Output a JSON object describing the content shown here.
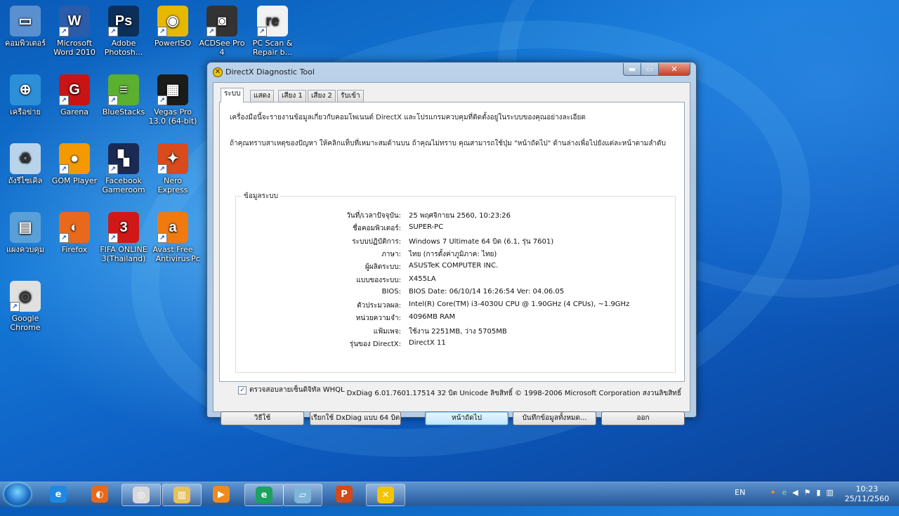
{
  "desktop": {
    "icons": [
      {
        "label": "คอมพิวเตอร์",
        "icon": "computer-icon",
        "color": "#5a8fd0",
        "glyph": "▭"
      },
      {
        "label": "Microsoft Word 2010",
        "icon": "word-icon",
        "color": "#2a5caa",
        "glyph": "W"
      },
      {
        "label": "Adobe Photosh...",
        "icon": "photoshop-icon",
        "color": "#0c2f5a",
        "glyph": "Ps"
      },
      {
        "label": "PowerISO",
        "icon": "poweriso-icon",
        "color": "#e6b800",
        "glyph": "◉"
      },
      {
        "label": "ACDSee Pro 4",
        "icon": "acdsee-icon",
        "color": "#333333",
        "glyph": "◙"
      },
      {
        "label": "PC Scan & Repair b...",
        "icon": "pcscan-icon",
        "color": "#f2f2f2",
        "glyph": "re"
      },
      {
        "label": "เครือข่าย",
        "icon": "network-icon",
        "color": "#2d8fd8",
        "glyph": "⊕"
      },
      {
        "label": "Garena",
        "icon": "garena-icon",
        "color": "#c81414",
        "glyph": "G"
      },
      {
        "label": "BlueStacks",
        "icon": "bluestacks-icon",
        "color": "#5bb030",
        "glyph": "≡"
      },
      {
        "label": "Vegas Pro 13.0 (64-bit)",
        "icon": "vegas-icon",
        "color": "#1b1b1b",
        "glyph": "▦"
      },
      {
        "label": "ถังรีไซเคิล",
        "icon": "recycle-bin-icon",
        "color": "#b9d4ea",
        "glyph": "♻"
      },
      {
        "label": "GOM Player",
        "icon": "gom-player-icon",
        "color": "#f29a00",
        "glyph": "●"
      },
      {
        "label": "Facebook Gameroom",
        "icon": "facebook-gameroom-icon",
        "color": "#1a2a55",
        "glyph": "▚"
      },
      {
        "label": "Nero Express",
        "icon": "nero-icon",
        "color": "#d94a1c",
        "glyph": "✦"
      },
      {
        "label": "แผงควบคุม",
        "icon": "control-panel-icon",
        "color": "#5aa0d8",
        "glyph": "▤"
      },
      {
        "label": "Firefox",
        "icon": "firefox-icon",
        "color": "#e8691c",
        "glyph": "◐"
      },
      {
        "label": "FIFA ONLINE 3(Thailand)",
        "icon": "fifa-icon",
        "color": "#d01818",
        "glyph": "3"
      },
      {
        "label": "Avast Free Antivirus",
        "icon": "avast-icon",
        "color": "#f07a10",
        "glyph": "a"
      },
      {
        "label": "Google Chrome",
        "icon": "chrome-icon",
        "color": "#e0e0e0",
        "glyph": "◎"
      }
    ],
    "partial_label": "Pc"
  },
  "window": {
    "title": "DirectX Diagnostic Tool",
    "controls": {
      "minimize": "▬",
      "maximize": "▭",
      "close": "✕"
    },
    "tabs": [
      "ระบบ",
      "แสดง",
      "เสียง 1",
      "เสียง 2",
      "รับเข้า"
    ],
    "intro1": "เครื่องมือนี้จะรายงานข้อมูลเกี่ยวกับคอมโพเนนต์ DirectX และโปรแกรมควบคุมที่ติดตั้งอยู่ในระบบของคุณอย่างละเอียด",
    "intro2": "ถ้าคุณทราบสาเหตุของปัญหา ให้คลิกแท็บที่เหมาะสมด้านบน ถ้าคุณไม่ทราบ คุณสามารถใช้ปุ่ม \"หน้าถัดไป\" ด้านล่างเพื่อไปยังแต่ละหน้าตามลำดับ",
    "group_title": "ข้อมูลระบบ",
    "info": [
      {
        "label": "วันที่/เวลาปัจจุบัน:",
        "value": "25 พฤศจิกายน 2560, 10:23:26"
      },
      {
        "label": "ชื่อคอมพิวเตอร์:",
        "value": "SUPER-PC"
      },
      {
        "label": "ระบบปฏิบัติการ:",
        "value": "Windows 7 Ultimate 64 บิต (6.1, รุ่น 7601)"
      },
      {
        "label": "ภาษา:",
        "value": "ไทย (การตั้งค่าภูมิภาค: ไทย)"
      },
      {
        "label": "ผู้ผลิตระบบ:",
        "value": "ASUSTeK COMPUTER INC."
      },
      {
        "label": "แบบของระบบ:",
        "value": "X455LA"
      },
      {
        "label": "BIOS:",
        "value": "BIOS Date: 06/10/14 16:26:54 Ver: 04.06.05"
      },
      {
        "label": "ตัวประมวลผล:",
        "value": "Intel(R) Core(TM) i3-4030U CPU @ 1.90GHz (4 CPUs), ~1.9GHz"
      },
      {
        "label": "หน่วยความจำ:",
        "value": "4096MB RAM"
      },
      {
        "label": "แฟ้มเพจ:",
        "value": "ใช้งาน 2251MB, ว่าง 5705MB"
      },
      {
        "label": "รุ่นของ DirectX:",
        "value": "DirectX 11"
      }
    ],
    "whql_label": "ตรวจสอบลายเซ็นดิจิทัล WHQL",
    "whql_checked": "✓",
    "copyright": "DxDiag 6.01.7601.17514 32 บิต Unicode  ลิขสิทธิ์ © 1998-2006 Microsoft Corporation  สงวนลิขสิทธิ์",
    "buttons": {
      "help": "วิธีใช้",
      "run64": "เรียกใช้ DxDiag แบบ 64 บิต",
      "next": "หน้าถัดไป",
      "save": "บันทึกข้อมูลทั้งหมด...",
      "exit": "ออก"
    }
  },
  "taskbar": {
    "items": [
      {
        "name": "ie-taskbar-icon",
        "color": "#1e88e5",
        "glyph": "e"
      },
      {
        "name": "firefox-taskbar-icon",
        "color": "#e8691c",
        "glyph": "◐"
      },
      {
        "name": "chrome-taskbar-icon",
        "color": "#d8d8d8",
        "glyph": "◎"
      },
      {
        "name": "explorer-taskbar-icon",
        "color": "#e7c15a",
        "glyph": "▥"
      },
      {
        "name": "media-player-taskbar-icon",
        "color": "#f08a1c",
        "glyph": "▶"
      },
      {
        "name": "line-taskbar-icon",
        "color": "#1aa260",
        "glyph": "e"
      },
      {
        "name": "app-taskbar-icon",
        "color": "#7fb5d8",
        "glyph": "▱"
      },
      {
        "name": "powerpoint-taskbar-icon",
        "color": "#d04a1c",
        "glyph": "P"
      },
      {
        "name": "directx-taskbar-icon",
        "color": "#f2c500",
        "glyph": "✕"
      }
    ],
    "language": "EN",
    "time": "10:23",
    "date": "25/11/2560"
  }
}
